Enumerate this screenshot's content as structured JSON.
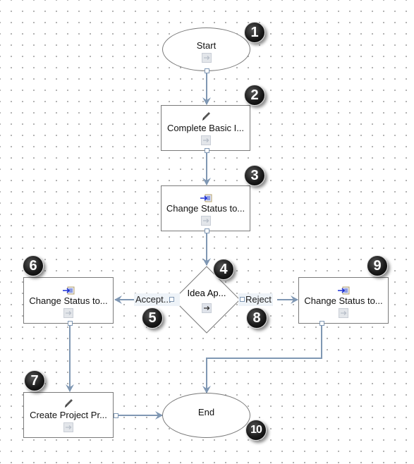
{
  "diagram": {
    "nodes": [
      {
        "id": "start",
        "label": "Start",
        "shape": "ellipse",
        "badge": "1"
      },
      {
        "id": "complete-basic",
        "label": "Complete Basic I...",
        "shape": "task",
        "icon": "pencil-icon",
        "badge": "2"
      },
      {
        "id": "change-status-1",
        "label": "Change Status to...",
        "shape": "task",
        "icon": "status-change-icon",
        "badge": "3"
      },
      {
        "id": "idea-approval",
        "label": "Idea Ap...",
        "shape": "decision",
        "badge": "4"
      },
      {
        "id": "change-status-accept",
        "label": "Change Status to...",
        "shape": "task",
        "icon": "status-change-icon",
        "badge": "6"
      },
      {
        "id": "create-project",
        "label": "Create Project Pr...",
        "shape": "task",
        "icon": "pencil-icon",
        "badge": "7"
      },
      {
        "id": "change-status-reject",
        "label": "Change Status to...",
        "shape": "task",
        "icon": "status-change-icon",
        "badge": "9"
      },
      {
        "id": "end",
        "label": "End",
        "shape": "ellipse",
        "badge": "10"
      }
    ],
    "edges": [
      {
        "from": "start",
        "to": "complete-basic",
        "label": ""
      },
      {
        "from": "complete-basic",
        "to": "change-status-1",
        "label": ""
      },
      {
        "from": "change-status-1",
        "to": "idea-approval",
        "label": ""
      },
      {
        "from": "idea-approval",
        "to": "change-status-accept",
        "label": "Accept...",
        "badge": "5"
      },
      {
        "from": "idea-approval",
        "to": "change-status-reject",
        "label": "Reject",
        "badge": "8"
      },
      {
        "from": "change-status-accept",
        "to": "create-project",
        "label": ""
      },
      {
        "from": "create-project",
        "to": "end",
        "label": ""
      },
      {
        "from": "change-status-reject",
        "to": "end",
        "label": ""
      }
    ]
  },
  "colors": {
    "connector": "#7f97b3",
    "node_border": "#7a7a7a",
    "edge_label_bg": "#eef3f8",
    "badge": "#000000"
  }
}
